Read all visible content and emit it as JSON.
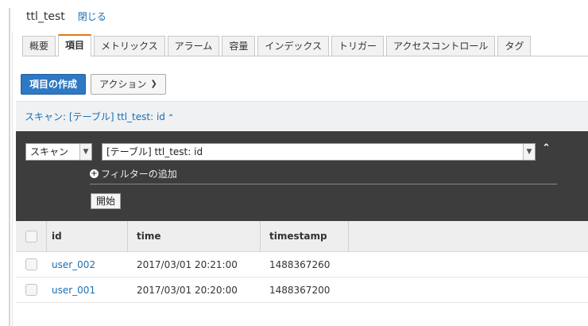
{
  "header": {
    "title": "ttl_test",
    "close_label": "閉じる"
  },
  "tabs": [
    {
      "label": "概要",
      "active": false
    },
    {
      "label": "項目",
      "active": true
    },
    {
      "label": "メトリックス",
      "active": false
    },
    {
      "label": "アラーム",
      "active": false
    },
    {
      "label": "容量",
      "active": false
    },
    {
      "label": "インデックス",
      "active": false
    },
    {
      "label": "トリガー",
      "active": false
    },
    {
      "label": "アクセスコントロール",
      "active": false
    },
    {
      "label": "タグ",
      "active": false
    }
  ],
  "toolbar": {
    "create_label": "項目の作成",
    "actions_label": "アクション"
  },
  "scan": {
    "toggle_label": "スキャン: [テーブル] ttl_test: id",
    "mode_value": "スキャン",
    "target_value": "[テーブル] ttl_test: id",
    "add_filter_label": "フィルターの追加",
    "start_label": "開始"
  },
  "table": {
    "columns": [
      "id",
      "time",
      "timestamp"
    ],
    "rows": [
      {
        "id": "user_002",
        "time": "2017/03/01 20:21:00",
        "timestamp": "1488367260"
      },
      {
        "id": "user_001",
        "time": "2017/03/01 20:20:00",
        "timestamp": "1488367200"
      }
    ]
  },
  "colors": {
    "accent_tab": "#e47911",
    "primary_button": "#2f78c4",
    "link": "#1a6fb3",
    "panel_dark": "#3d3d3d"
  }
}
